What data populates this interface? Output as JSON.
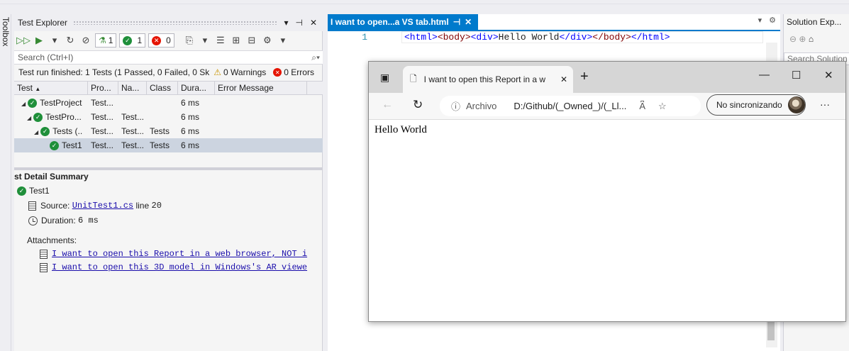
{
  "toolbox": {
    "label": "Toolbox"
  },
  "test_explorer": {
    "title": "Test Explorer",
    "header_buttons": [
      "▾",
      "⊣",
      "✕"
    ],
    "counts": {
      "total": "1",
      "passed": "1",
      "failed": "0"
    },
    "search_placeholder": "Search (Ctrl+I)",
    "status": "Test run finished: 1 Tests (1 Passed, 0 Failed, 0 Sk",
    "warnings": "0 Warnings",
    "errors": "0 Errors",
    "columns": [
      "Test",
      "Pro...",
      "Na...",
      "Class",
      "Dura...",
      "Error Message"
    ],
    "rows": [
      {
        "name": "TestProject",
        "project": "Test...",
        "namespace": "",
        "class": "",
        "duration": "6 ms"
      },
      {
        "name": "TestPro...",
        "project": "Test...",
        "namespace": "Test...",
        "class": "",
        "duration": "6 ms"
      },
      {
        "name": "Tests (..",
        "project": "Test...",
        "namespace": "Test...",
        "class": "Tests",
        "duration": "6 ms"
      },
      {
        "name": "Test1",
        "project": "Test...",
        "namespace": "Test...",
        "class": "Tests",
        "duration": "6 ms"
      }
    ],
    "detail": {
      "title": "st Detail Summary",
      "test_name": "Test1",
      "source_label": "Source:",
      "source_file": "UnitTest1.cs",
      "source_line": "line",
      "source_line_no": "20",
      "duration_label": "Duration:",
      "duration_value": "6 ms",
      "attachments_label": "Attachments:",
      "attachments": [
        "I want to open this Report in a web browser, NOT i",
        "I want to open this 3D model in Windows's AR viewe"
      ]
    }
  },
  "editor": {
    "tab_title": "I want to open...a VS tab.html",
    "line_number": "1",
    "code": {
      "t1": "<html>",
      "t2": "<body>",
      "t3": "<div>",
      "text": "Hello World",
      "t4": "</div>",
      "t5": "</body>",
      "t6": "</html>"
    }
  },
  "solution_explorer": {
    "title": "Solution Exp...",
    "search": "Search Solution"
  },
  "browser": {
    "tab_title": "I want to open this Report in a w",
    "url_prefix": "Archivo",
    "url": "D:/Github/(_Owned_)/(_Ll...",
    "sync_label": "No sincronizando",
    "page_text": "Hello World"
  }
}
